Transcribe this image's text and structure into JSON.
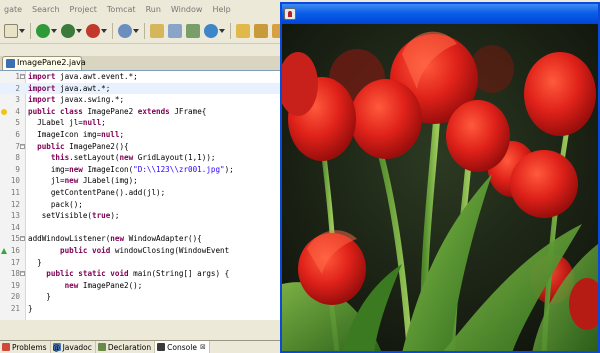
{
  "menubar": {
    "items": [
      "gate",
      "Search",
      "Project",
      "Tomcat",
      "Run",
      "Window",
      "Help"
    ]
  },
  "toolbar": {
    "icons": [
      "new-file-icon",
      "run-icon",
      "debug-icon",
      "external-tools-icon",
      "search-icon",
      "open-type-icon",
      "open-task-icon",
      "open-resource-icon",
      "folder-icon",
      "build-icon",
      "tomcat-icon",
      "globe-icon"
    ]
  },
  "editor": {
    "tab_label": "ImagePane2.java",
    "lines": [
      {
        "n": "1",
        "fold": "⊖",
        "html": "<span class=\"kw\">import</span> java.awt.event.*;"
      },
      {
        "n": "2",
        "fold": "",
        "html": "<span class=\"kw\">import</span> java.awt.*;"
      },
      {
        "n": "3",
        "fold": "",
        "html": "<span class=\"kw\">import</span> javax.swing.*;"
      },
      {
        "n": "4",
        "fold": "",
        "html": "<span class=\"kw\">public class</span> ImagePane2 <span class=\"kw\">extends</span> JFrame{"
      },
      {
        "n": "5",
        "fold": "",
        "html": "  JLabel jl=<span class=\"kw\">null</span>;"
      },
      {
        "n": "6",
        "fold": "",
        "html": "  ImageIcon img=<span class=\"kw\">null</span>;"
      },
      {
        "n": "7",
        "fold": "⊖",
        "html": "  <span class=\"kw\">public</span> ImagePane2(){"
      },
      {
        "n": "8",
        "fold": "",
        "html": "     <span class=\"kw\">this</span>.setLayout(<span class=\"kw\">new</span> GridLayout(1,1));"
      },
      {
        "n": "9",
        "fold": "",
        "html": "     img=<span class=\"kw\">new</span> ImageIcon(<span class=\"str\">\"D:\\\\123\\\\zr001.jpg\"</span>);"
      },
      {
        "n": "10",
        "fold": "",
        "html": "     jl=<span class=\"kw\">new</span> JLabel(img);"
      },
      {
        "n": "11",
        "fold": "",
        "html": "     getContentPane().add(jl);"
      },
      {
        "n": "12",
        "fold": "",
        "html": "     pack();"
      },
      {
        "n": "13",
        "fold": "",
        "html": "   setVisible(<span class=\"kw\">true</span>);"
      },
      {
        "n": "14",
        "fold": "",
        "html": ""
      },
      {
        "n": "15",
        "fold": "⊖",
        "html": "addWindowListener(<span class=\"kw\">new</span> WindowAdapter(){"
      },
      {
        "n": "16",
        "fold": "",
        "html": "       <span class=\"kw\">public void</span> windowClosing(WindowEvent"
      },
      {
        "n": "17",
        "fold": "",
        "html": "  }"
      },
      {
        "n": "18",
        "fold": "⊖",
        "html": "    <span class=\"kw\">public static void</span> main(String[] args) {"
      },
      {
        "n": "19",
        "fold": "",
        "html": "        <span class=\"kw\">new</span> ImagePane2();"
      },
      {
        "n": "20",
        "fold": "",
        "html": "    }"
      },
      {
        "n": "21",
        "fold": "",
        "html": "}"
      }
    ]
  },
  "bottom_tabs": {
    "problems": "Problems",
    "javadoc": "Javadoc",
    "declaration": "Declaration",
    "console": "Console",
    "close_glyph": "⊠"
  },
  "frame": {
    "title": "",
    "image_subject": "red tulips photograph"
  }
}
